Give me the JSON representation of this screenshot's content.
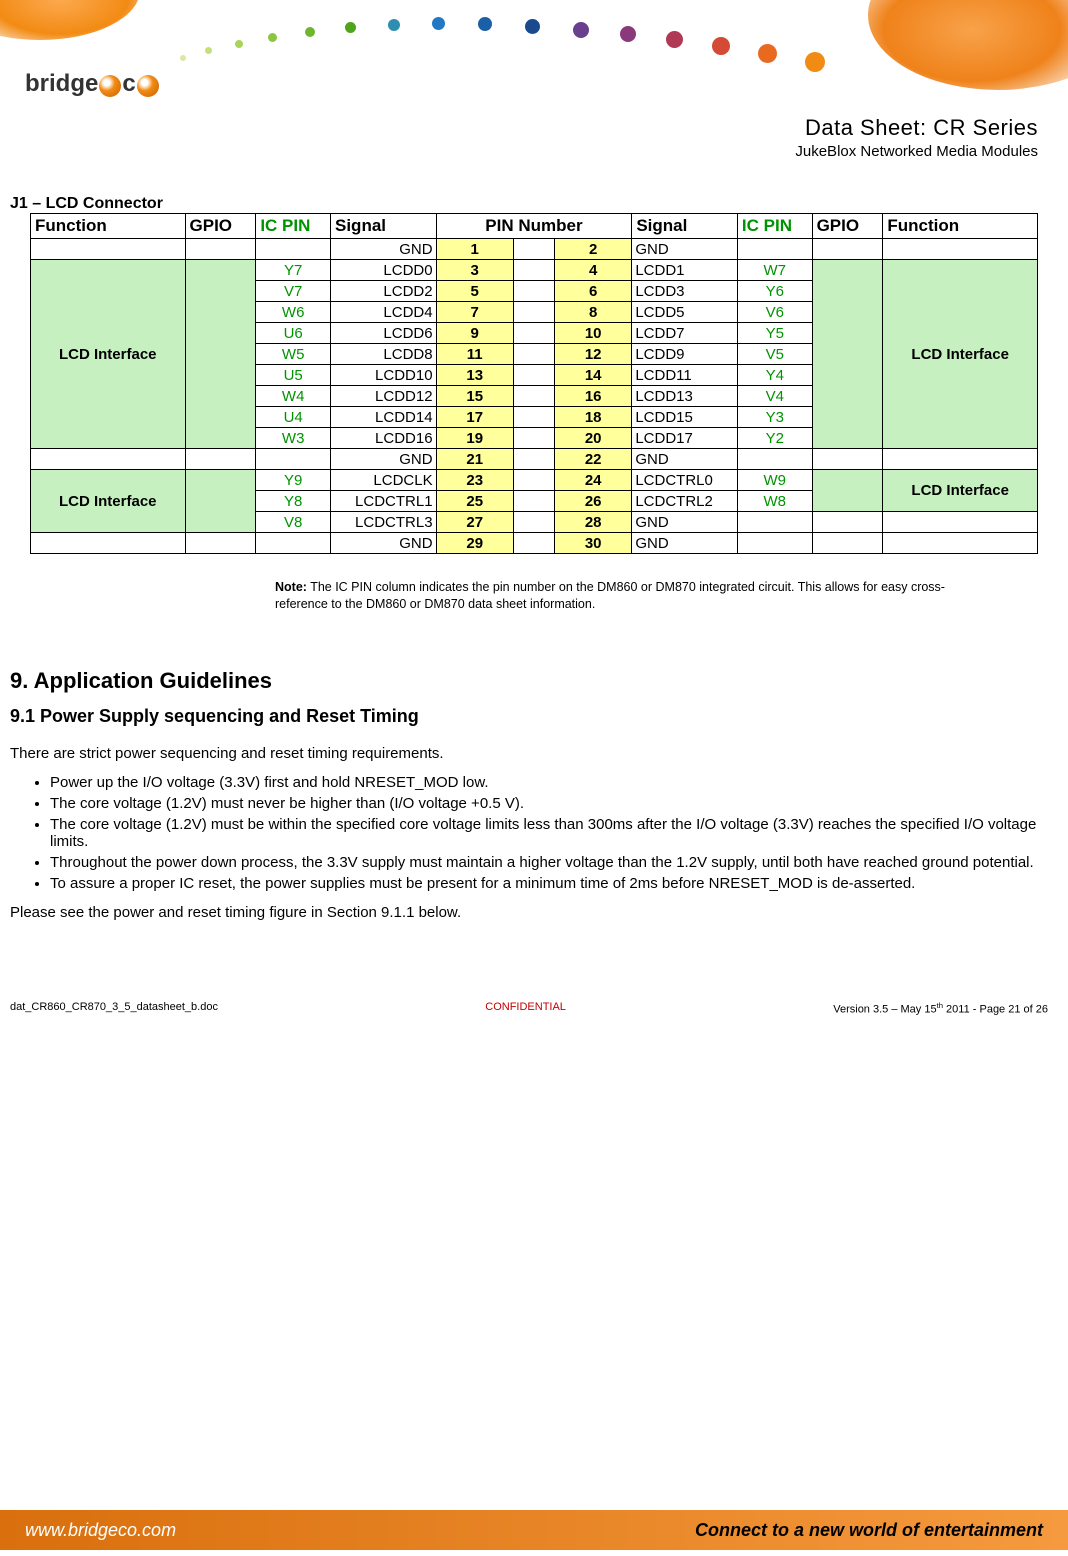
{
  "header": {
    "title": "Data Sheet: CR Series",
    "subtitle": "JukeBlox Networked Media Modules",
    "logo_text_prefix": "bridge",
    "logo_text_suffix": "c"
  },
  "section_title": "J1 – LCD Connector",
  "table": {
    "headers": [
      "Function",
      "GPIO",
      "IC PIN",
      "Signal",
      "PIN Number",
      "Signal",
      "IC PIN",
      "GPIO",
      "Function"
    ],
    "rows": [
      {
        "funcL": "",
        "gpioL": "",
        "icL": "",
        "sigL": "GND",
        "pinL": "1",
        "pinR": "2",
        "sigR": "GND",
        "icR": "",
        "gpioR": "",
        "funcR": "",
        "sepL": true,
        "sepR": true
      },
      {
        "funcL": "LCD Interface",
        "funcLspan": 9,
        "gpioL": "",
        "gpioLspan": 9,
        "icL": "Y7",
        "sigL": "LCDD0",
        "pinL": "3",
        "pinR": "4",
        "sigR": "LCDD1",
        "icR": "W7",
        "gpioR": "",
        "gpioRspan": 9,
        "funcR": "LCD Interface",
        "funcRspan": 9,
        "lcdL": true,
        "lcdR": true
      },
      {
        "icL": "V7",
        "sigL": "LCDD2",
        "pinL": "5",
        "pinR": "6",
        "sigR": "LCDD3",
        "icR": "Y6"
      },
      {
        "icL": "W6",
        "sigL": "LCDD4",
        "pinL": "7",
        "pinR": "8",
        "sigR": "LCDD5",
        "icR": "V6"
      },
      {
        "icL": "U6",
        "sigL": "LCDD6",
        "pinL": "9",
        "pinR": "10",
        "sigR": "LCDD7",
        "icR": "Y5"
      },
      {
        "icL": "W5",
        "sigL": "LCDD8",
        "pinL": "11",
        "pinR": "12",
        "sigR": "LCDD9",
        "icR": "V5"
      },
      {
        "icL": "U5",
        "sigL": "LCDD10",
        "pinL": "13",
        "pinR": "14",
        "sigR": "LCDD11",
        "icR": "Y4"
      },
      {
        "icL": "W4",
        "sigL": "LCDD12",
        "pinL": "15",
        "pinR": "16",
        "sigR": "LCDD13",
        "icR": "V4"
      },
      {
        "icL": "U4",
        "sigL": "LCDD14",
        "pinL": "17",
        "pinR": "18",
        "sigR": "LCDD15",
        "icR": "Y3"
      },
      {
        "icL": "W3",
        "sigL": "LCDD16",
        "pinL": "19",
        "pinR": "20",
        "sigR": "LCDD17",
        "icR": "Y2"
      },
      {
        "funcL": "",
        "gpioL": "",
        "icL": "",
        "sigL": "GND",
        "pinL": "21",
        "pinR": "22",
        "sigR": "GND",
        "icR": "",
        "gpioR": "",
        "funcR": "",
        "sepL": true,
        "sepR": true
      },
      {
        "funcL": "LCD Interface",
        "funcLspan": 3,
        "gpioL": "",
        "gpioLspan": 3,
        "icL": "Y9",
        "sigL": "LCDCLK",
        "pinL": "23",
        "pinR": "24",
        "sigR": "LCDCTRL0",
        "icR": "W9",
        "gpioR": "",
        "gpioRspan": 2,
        "funcR": "LCD Interface",
        "funcRspan": 2,
        "lcdL": true,
        "lcdR": true
      },
      {
        "icL": "Y8",
        "sigL": "LCDCTRL1",
        "pinL": "25",
        "pinR": "26",
        "sigR": "LCDCTRL2",
        "icR": "W8"
      },
      {
        "icL": "V8",
        "sigL": "LCDCTRL3",
        "pinL": "27",
        "pinR": "28",
        "sigR": "GND",
        "icR": "",
        "gpioR": "",
        "funcR": "",
        "sepR": true
      },
      {
        "funcL": "",
        "gpioL": "",
        "icL": "",
        "sigL": "GND",
        "pinL": "29",
        "pinR": "30",
        "sigR": "GND",
        "icR": "",
        "gpioR": "",
        "funcR": "",
        "sepL": true,
        "sepR": true
      }
    ]
  },
  "note": {
    "label": "Note:",
    "text": " The IC PIN column indicates the pin number on the DM860 or DM870 integrated circuit. This allows for easy cross-reference to the DM860 or DM870 data sheet information."
  },
  "h2": "9. Application Guidelines",
  "h3": "9.1 Power Supply sequencing and Reset Timing",
  "p1": "There are strict power sequencing and reset timing requirements.",
  "bullets": [
    "Power up the I/O voltage (3.3V) first and hold NRESET_MOD low.",
    "The core voltage (1.2V) must never be higher than (I/O voltage +0.5 V).",
    "The core voltage (1.2V) must be within the specified core voltage limits less than 300ms after the I/O voltage (3.3V) reaches the specified I/O voltage limits.",
    "Throughout the power down process, the 3.3V supply must maintain a higher voltage than the 1.2V supply, until both have reached ground potential.",
    "To assure a proper IC reset, the power supplies must be present for a minimum time of 2ms before NRESET_MOD is de-asserted."
  ],
  "p2": "Please see the power and reset timing figure in Section 9.1.1 below.",
  "footer": {
    "left": "dat_CR860_CR870_3_5_datasheet_b.doc",
    "center": "CONFIDENTIAL",
    "right_prefix": "Version 3.5 – May 15",
    "right_sup": "th",
    "right_suffix": " 2011 - Page 21 of 26"
  },
  "bottom": {
    "www": "www.bridgeco.com",
    "tagline": "Connect to a new world of entertainment"
  }
}
